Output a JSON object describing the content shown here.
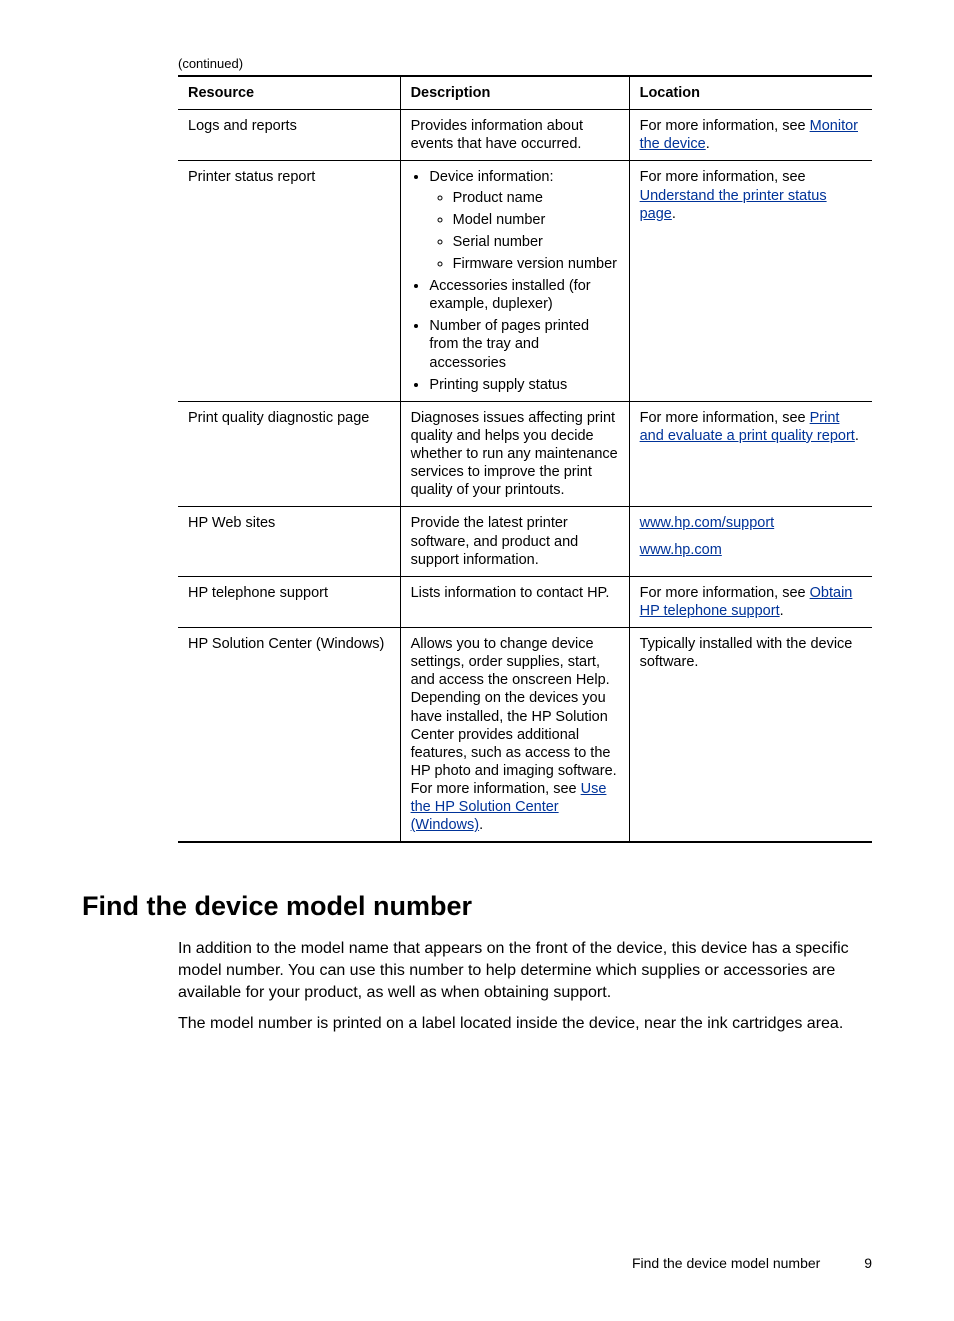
{
  "continued_label": "(continued)",
  "table_headers": {
    "resource": "Resource",
    "description": "Description",
    "location": "Location"
  },
  "rows": {
    "logs": {
      "resource": "Logs and reports",
      "description": "Provides information about events that have occurred.",
      "loc_prefix": "For more information, see ",
      "loc_link": "Monitor the device",
      "loc_suffix": "."
    },
    "status": {
      "resource": "Printer status report",
      "b0": "Device information:",
      "s0": "Product name",
      "s1": "Model number",
      "s2": "Serial number",
      "s3": "Firmware version number",
      "b1": "Accessories installed (for example, duplexer)",
      "b2": "Number of pages printed from the tray and accessories",
      "b3": "Printing supply status",
      "loc_prefix": "For more information, see ",
      "loc_link": "Understand the printer status page",
      "loc_suffix": "."
    },
    "pq": {
      "resource": "Print quality diagnostic page",
      "description": "Diagnoses issues affecting print quality and helps you decide whether to run any maintenance services to improve the print quality of your printouts.",
      "loc_prefix": "For more information, see ",
      "loc_link": "Print and evaluate a print quality report",
      "loc_suffix": "."
    },
    "web": {
      "resource": "HP Web sites",
      "description": "Provide the latest printer software, and product and support information.",
      "link1": "www.hp.com/support",
      "link2": "www.hp.com"
    },
    "tel": {
      "resource": "HP telephone support",
      "description": "Lists information to contact HP.",
      "loc_prefix": "For more information, see ",
      "loc_link": "Obtain HP telephone support",
      "loc_suffix": "."
    },
    "sc": {
      "resource": "HP Solution Center (Windows)",
      "desc_part1": "Allows you to change device settings, order supplies, start, and access the onscreen Help. Depending on the devices you have installed, the HP Solution Center provides additional features, such as access to the HP photo and imaging software. For more information, see ",
      "desc_link": "Use the HP Solution Center (Windows)",
      "desc_part2": ".",
      "location": "Typically installed with the device software."
    }
  },
  "heading": "Find the device model number",
  "para1": "In addition to the model name that appears on the front of the device, this device has a specific model number. You can use this number to help determine which supplies or accessories are available for your product, as well as when obtaining support.",
  "para2": "The model number is printed on a label located inside the device, near the ink cartridges area.",
  "footer": {
    "title": "Find the device model number",
    "page": "9"
  }
}
